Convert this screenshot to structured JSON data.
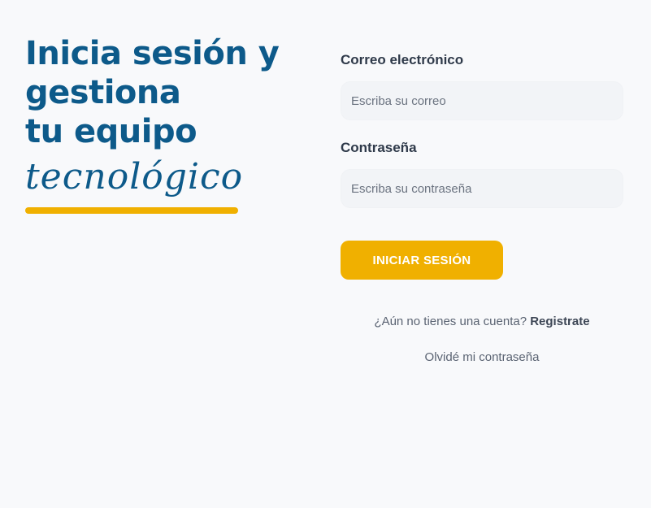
{
  "hero": {
    "line1": "Inicia sesión y",
    "line2": "gestiona",
    "line3": "tu equipo",
    "script_word": "tecnológico"
  },
  "form": {
    "email_label": "Correo electrónico",
    "email_placeholder": "Escriba su correo",
    "email_value": "",
    "password_label": "Contraseña",
    "password_placeholder": "Escriba su contraseña",
    "password_value": "",
    "submit_label": "INICIAR SESIÓN"
  },
  "links": {
    "signup_prompt": "¿Aún no tienes una cuenta?",
    "signup_link": "Registrate",
    "forgot_password": "Olvidé mi contraseña"
  },
  "colors": {
    "brand_blue": "#0d5a8a",
    "accent_yellow": "#f0b000",
    "background": "#f8f9fb"
  }
}
